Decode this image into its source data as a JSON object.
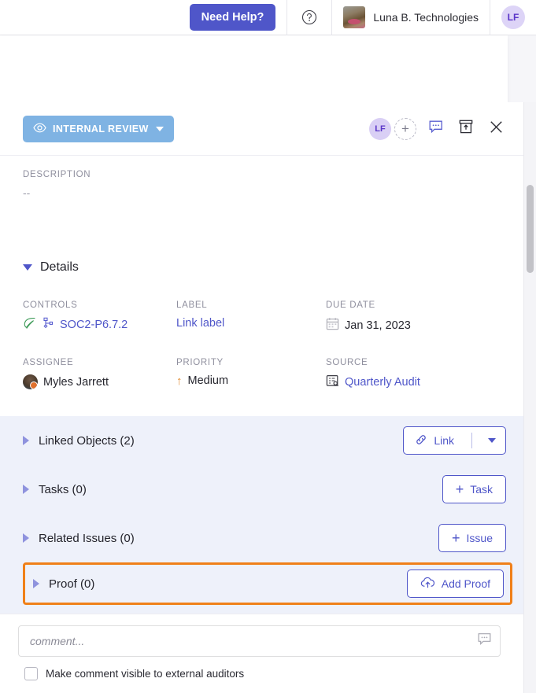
{
  "topbar": {
    "need_help_label": "Need Help?",
    "help_icon": "question-circle-icon",
    "org_name": "Luna B. Technologies",
    "user_initials": "LF"
  },
  "panel": {
    "status": {
      "label": "INTERNAL REVIEW",
      "icon": "eye-icon",
      "color": "#7fb3e3"
    },
    "actions": {
      "assignee_initials": "LF",
      "add_person_glyph": "+",
      "comment_icon": "comment-bubble-icon",
      "archive_icon": "archive-box-icon",
      "close_icon": "close-x-icon"
    },
    "description": {
      "label": "DESCRIPTION",
      "value": "--"
    },
    "details": {
      "title": "Details",
      "fields": [
        {
          "label": "CONTROLS",
          "value": "SOC2-P6.7.2",
          "icon": "leaf-icon",
          "icon2": "node-hierarchy-icon",
          "link": true
        },
        {
          "label": "LABEL",
          "value": "Link label",
          "link": true
        },
        {
          "label": "DUE DATE",
          "value": "Jan 31, 2023",
          "icon": "calendar-icon",
          "link": false
        },
        {
          "label": "ASSIGNEE",
          "value": "Myles Jarrett",
          "icon": "user-avatar",
          "link": false
        },
        {
          "label": "PRIORITY",
          "value": "Medium",
          "icon": "arrow-up-icon",
          "link": false
        },
        {
          "label": "SOURCE",
          "value": "Quarterly Audit",
          "icon": "document-search-icon",
          "link": true
        }
      ]
    },
    "sections": [
      {
        "name": "Linked Objects (2)",
        "button_label": "Link",
        "button_icon": "chain-link-icon",
        "has_dropdown": true,
        "highlighted": false
      },
      {
        "name": "Tasks (0)",
        "button_label": "Task",
        "button_icon": "plus-icon",
        "has_dropdown": false,
        "highlighted": false
      },
      {
        "name": "Related Issues (0)",
        "button_label": "Issue",
        "button_icon": "plus-icon",
        "has_dropdown": false,
        "highlighted": false
      },
      {
        "name": "Proof (0)",
        "button_label": "Add Proof",
        "button_icon": "cloud-upload-icon",
        "has_dropdown": false,
        "highlighted": true,
        "highlight_color": "#f08019"
      }
    ],
    "footer": {
      "comment_placeholder": "comment...",
      "comment_value": "",
      "comment_icon": "comment-bubble-icon",
      "checkbox_label": "Make comment visible to external auditors",
      "checkbox_checked": false
    }
  },
  "colors": {
    "accent": "#4f56c9",
    "status_blue": "#7fb3e3",
    "highlight_orange": "#f08019",
    "section_bg": "#eef1fa"
  }
}
